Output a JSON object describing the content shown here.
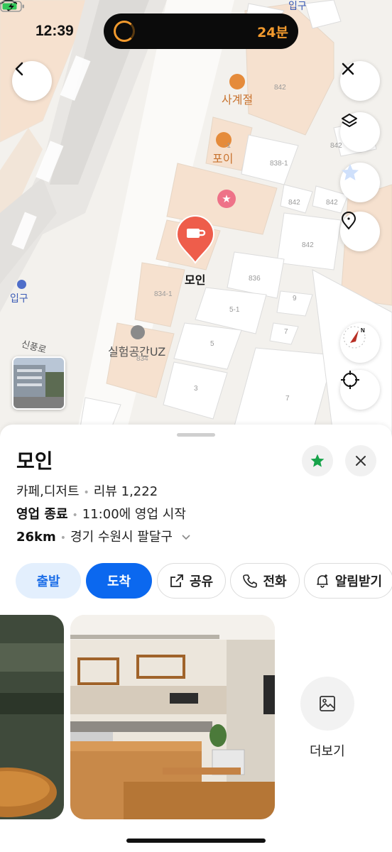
{
  "status_bar": {
    "time": "12:39",
    "eta": "24분"
  },
  "map": {
    "labels": {
      "entrance_top": "입구",
      "entrance_left": "입구",
      "poi_sagyejeol": "사계절",
      "poi_poi": "포이",
      "poi_moin": "모인",
      "poi_lab": "실험공간UZ",
      "street": "신풍로"
    },
    "lot_numbers": [
      "842",
      "838-1",
      "842",
      "842",
      "842",
      "842",
      "836",
      "834-1",
      "5-1",
      "9",
      "7",
      "5",
      "834",
      "3",
      "7",
      "-1"
    ]
  },
  "place": {
    "name": "모인",
    "category": "카페,디저트",
    "reviews": "리뷰 1,222",
    "open_status": "영업 종료",
    "open_next": "11:00에 영업 시작",
    "distance": "26km",
    "address": "경기 수원시 팔달구"
  },
  "actions": {
    "start": "출발",
    "arrive": "도착",
    "share": "공유",
    "call": "전화",
    "notify": "알림받기"
  },
  "photos": {
    "more_label": "더보기"
  },
  "colors": {
    "accent_blue": "#0b68ef",
    "poi_red": "#ee5d4b",
    "poi_orange": "#c8732f",
    "fav_green": "#17a34a",
    "eta_orange": "#f29a2e"
  }
}
